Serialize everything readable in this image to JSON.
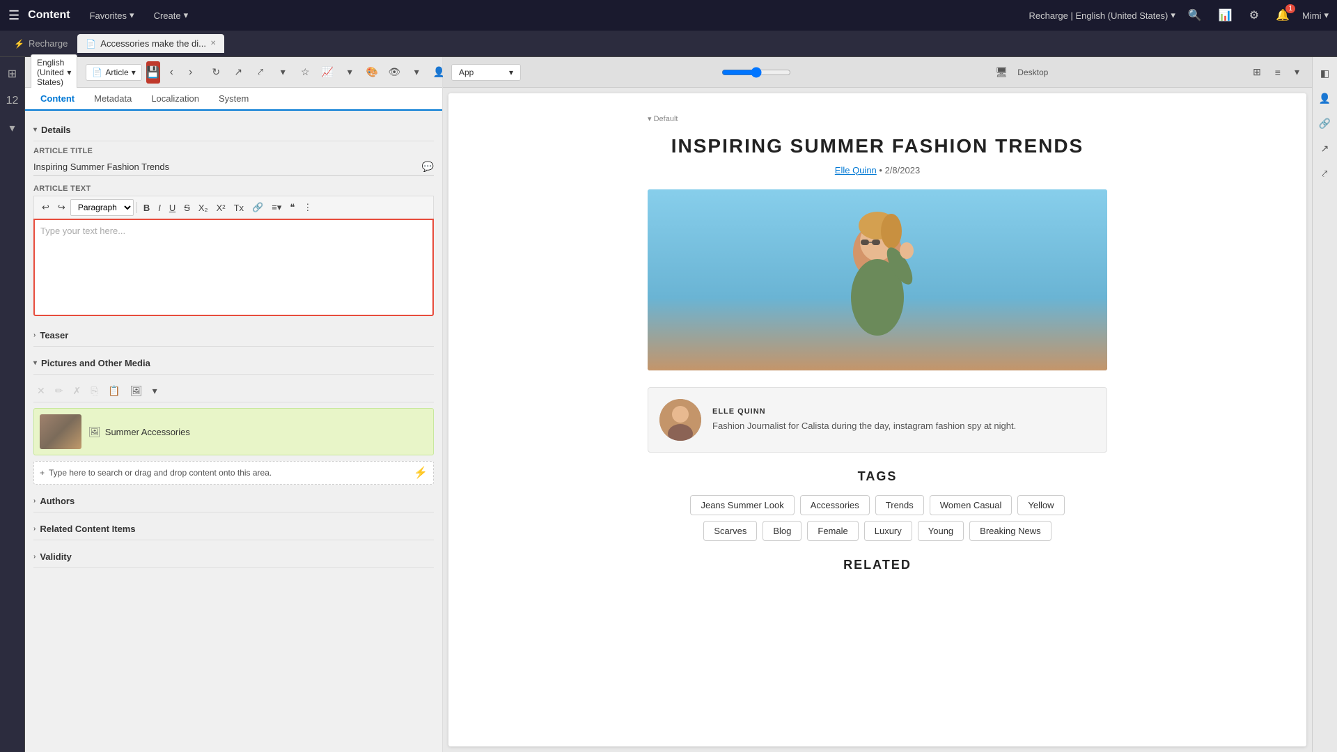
{
  "topNav": {
    "appTitle": "Content",
    "favoritesLabel": "Favorites",
    "createLabel": "Create",
    "siteSelector": "Recharge | English (United States)",
    "userLabel": "Mimi"
  },
  "tabs": [
    {
      "id": "recharge",
      "label": "Recharge",
      "active": false,
      "icon": "⚡"
    },
    {
      "id": "article",
      "label": "Accessories make the di...",
      "active": true,
      "icon": "📄"
    }
  ],
  "editorToolbar": {
    "languageLabel": "English (United States)",
    "articleTypeLabel": "Article",
    "prevArrow": "‹",
    "nextArrow": "›"
  },
  "contentTabs": [
    {
      "id": "content",
      "label": "Content",
      "active": true
    },
    {
      "id": "metadata",
      "label": "Metadata",
      "active": false
    },
    {
      "id": "localization",
      "label": "Localization",
      "active": false
    },
    {
      "id": "system",
      "label": "System",
      "active": false
    }
  ],
  "details": {
    "sectionLabel": "Details",
    "articleTitleLabel": "Article Title",
    "articleTitleValue": "Inspiring Summer Fashion Trends",
    "articleTextLabel": "Article Text",
    "textPlaceholder": "Type your text here...",
    "paragraphLabel": "Paragraph"
  },
  "teaser": {
    "sectionLabel": "Teaser"
  },
  "media": {
    "sectionLabel": "Pictures and Other Media",
    "itemLabel": "Summer Accessories",
    "addPlaceholder": "Type here to search or drag and drop content onto this area."
  },
  "authors": {
    "sectionLabel": "Authors"
  },
  "related": {
    "sectionLabel": "Related Content Items"
  },
  "validity": {
    "sectionLabel": "Validity"
  },
  "preview": {
    "defaultLabel": "Default",
    "viewLabel": "App",
    "deviceLabel": "Desktop",
    "articleTitle": "Inspiring Summer Fashion Trends",
    "bylineAuthor": "Elle Quinn",
    "bylineDate": "2/8/2023",
    "authorCardName": "ELLE QUINN",
    "authorCardBio": "Fashion Journalist for Calista during the day, instagram fashion spy at night.",
    "tagsTitle": "TAGS",
    "tags": [
      "Jeans Summer Look",
      "Accessories",
      "Trends",
      "Women Casual",
      "Yellow",
      "Scarves",
      "Blog",
      "Female",
      "Luxury",
      "Young",
      "Breaking News"
    ],
    "relatedTitle": "RELATED"
  }
}
